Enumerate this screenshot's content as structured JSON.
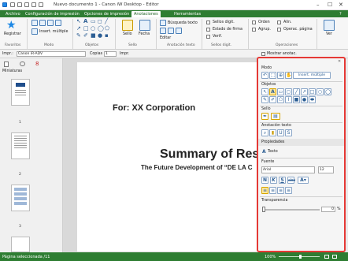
{
  "window": {
    "title": "Nuevo documento 1 - Canon iW Desktop - Editor",
    "minimize": "–",
    "maximize": "☐",
    "close": "✕"
  },
  "menu": {
    "tabs": [
      "Archivo",
      "Configuración de impresión",
      "Opciones de impresión",
      "Anotaciones",
      "Herramientas"
    ],
    "help": "?"
  },
  "ribbon": {
    "registrar": "Registrar",
    "insert_multiple": "Insert. múltiple",
    "sello": "Sello",
    "fecha": "Fecha",
    "busqueda_texto": "Búsqueda texto",
    "editar": "Editar",
    "sellos_digit": "Sellos digit.",
    "estado_firma": "Estado de firma",
    "verif": "Verif.",
    "orden": "Orden",
    "agrup": "Agrup.",
    "alin": "Alin.",
    "operac_pagina": "Operac. página",
    "ver": "Ver",
    "groups": [
      "Favoritos",
      "Modo",
      "Objetos",
      "Sello",
      "Anotación texto",
      "Sellos digit.",
      "Operaciones"
    ]
  },
  "toolbar2": {
    "printer_label": "Impr.:",
    "printer_value": "Canon iR-ADV",
    "copies_label": "Copias",
    "copies_value": "1",
    "impr_button": "Impr.",
    "mostrar_anotac": "Mostrar anotac."
  },
  "left_pane": {
    "title": "Miniaturas",
    "pages": [
      "1",
      "2",
      "3"
    ]
  },
  "document": {
    "for_line": "For: XX Corporation",
    "summary_title": "Summary of Rese",
    "subtitle": "The Future Development of “DE LA C"
  },
  "panel": {
    "modo_title": "Modo",
    "insert_multiple": "Insert. múltiple",
    "objetos_title": "Objetos",
    "sello_title": "Sello",
    "anotacion_title": "Anotación texto",
    "propiedades_title": "Propiedades",
    "texto_label": "Texto",
    "fuente_title": "Fuente",
    "font_name": "Arial",
    "font_size": "12",
    "transparencia_title": "Transparencia",
    "transparency_value": "0",
    "percent": "%"
  },
  "status": {
    "page_selected": "Página seleccionada /11",
    "zoom": "100%"
  },
  "colors": {
    "accent": "#2e7d32",
    "panel_border": "#e53935"
  }
}
